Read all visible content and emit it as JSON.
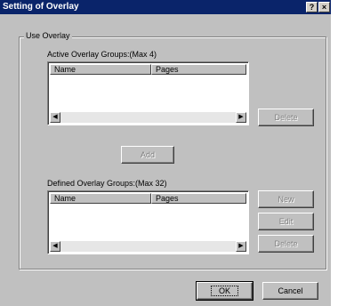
{
  "window": {
    "title": "Setting of Overlay",
    "help_button": "?",
    "close_button": "×"
  },
  "group": {
    "label": "Use Overlay",
    "active": {
      "label": "Active Overlay Groups:(Max 4)",
      "columns": [
        "Name",
        "Pages"
      ],
      "delete_label": "Delete"
    },
    "add_label": "Add",
    "defined": {
      "label": "Defined Overlay Groups:(Max 32)",
      "columns": [
        "Name",
        "Pages"
      ],
      "new_label": "New",
      "edit_label": "Edit",
      "delete_label": "Delete"
    }
  },
  "footer": {
    "ok_label": "OK",
    "cancel_label": "Cancel"
  },
  "icons": {
    "scroll_left": "◀",
    "scroll_right": "▶"
  }
}
